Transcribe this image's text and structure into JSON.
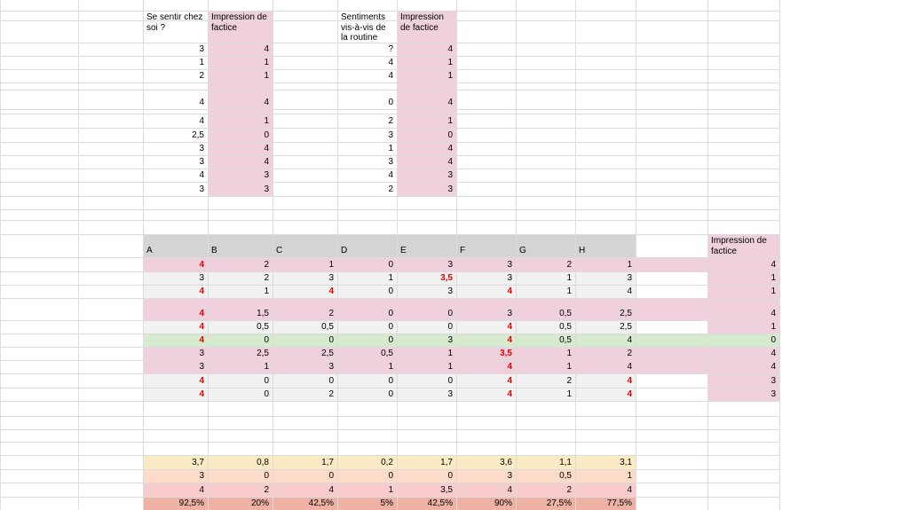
{
  "top_left": {
    "headers": [
      "Se sentir chez soi ?",
      "Impression de factice"
    ],
    "rows": [
      [
        "3",
        "4"
      ],
      [
        "1",
        "1"
      ],
      [
        "2",
        "1"
      ],
      [
        "4",
        "4"
      ],
      [
        "4",
        "1"
      ],
      [
        "2,5",
        "0"
      ],
      [
        "3",
        "4"
      ],
      [
        "3",
        "4"
      ],
      [
        "4",
        "3"
      ],
      [
        "3",
        "3"
      ]
    ]
  },
  "top_right": {
    "headers": [
      "Sentiments vis-à-vis de la routine",
      "Impression de factice"
    ],
    "rows": [
      [
        "?",
        "4"
      ],
      [
        "4",
        "1"
      ],
      [
        "4",
        "1"
      ],
      [
        "0",
        "4"
      ],
      [
        "2",
        "1"
      ],
      [
        "3",
        "0"
      ],
      [
        "1",
        "4"
      ],
      [
        "3",
        "4"
      ],
      [
        "4",
        "3"
      ],
      [
        "2",
        "3"
      ]
    ]
  },
  "main_table": {
    "columns": [
      "A",
      "B",
      "C",
      "D",
      "E",
      "F",
      "G",
      "H"
    ],
    "rows": [
      [
        "4",
        "2",
        "1",
        "0",
        "3",
        "3",
        "2",
        "1"
      ],
      [
        "3",
        "2",
        "3",
        "1",
        "3,5",
        "3",
        "1",
        "3"
      ],
      [
        "4",
        "1",
        "4",
        "0",
        "3",
        "4",
        "1",
        "4"
      ],
      [
        "4",
        "1,5",
        "2",
        "0",
        "0",
        "3",
        "0,5",
        "2,5"
      ],
      [
        "4",
        "0,5",
        "0,5",
        "0",
        "0",
        "4",
        "0,5",
        "2,5"
      ],
      [
        "4",
        "0",
        "0",
        "0",
        "3",
        "4",
        "0,5",
        "4"
      ],
      [
        "3",
        "2,5",
        "2,5",
        "0,5",
        "1",
        "3,5",
        "1",
        "2"
      ],
      [
        "3",
        "1",
        "3",
        "1",
        "1",
        "4",
        "1",
        "4"
      ],
      [
        "4",
        "0",
        "0",
        "0",
        "0",
        "4",
        "2",
        "4"
      ],
      [
        "4",
        "0",
        "2",
        "0",
        "3",
        "4",
        "1",
        "4"
      ]
    ],
    "emphasis": [
      [
        true,
        false,
        false,
        false,
        false,
        false,
        false,
        false
      ],
      [
        false,
        false,
        false,
        false,
        true,
        false,
        false,
        false
      ],
      [
        true,
        false,
        true,
        false,
        false,
        true,
        false,
        false
      ],
      [
        true,
        false,
        false,
        false,
        false,
        false,
        false,
        false
      ],
      [
        true,
        false,
        false,
        false,
        false,
        true,
        false,
        false
      ],
      [
        true,
        false,
        false,
        false,
        false,
        true,
        false,
        false
      ],
      [
        false,
        false,
        false,
        false,
        false,
        true,
        false,
        false
      ],
      [
        false,
        false,
        false,
        false,
        false,
        true,
        false,
        false
      ],
      [
        true,
        false,
        false,
        false,
        false,
        true,
        false,
        true
      ],
      [
        true,
        false,
        false,
        false,
        false,
        true,
        false,
        true
      ]
    ],
    "row_styles": [
      "pink",
      "lgray",
      "lgray",
      "pink",
      "lgray",
      "green",
      "pink",
      "pink",
      "lgray",
      "lgray"
    ]
  },
  "side_column": {
    "header": "Impression de factice",
    "values": [
      "4",
      "1",
      "1",
      "4",
      "1",
      "0",
      "4",
      "4",
      "3",
      "3"
    ]
  },
  "summary": {
    "rows": [
      [
        "3,7",
        "0,8",
        "1,7",
        "0,2",
        "1,7",
        "3,6",
        "1,1",
        "3,1"
      ],
      [
        "3",
        "0",
        "0",
        "0",
        "0",
        "3",
        "0,5",
        "1"
      ],
      [
        "4",
        "2",
        "4",
        "1",
        "3,5",
        "4",
        "2",
        "4"
      ],
      [
        "92,5%",
        "20%",
        "42,5%",
        "5%",
        "42,5%",
        "90%",
        "27,5%",
        "77,5%"
      ]
    ],
    "row_styles": [
      "yel",
      "org",
      "rose",
      "salm"
    ]
  },
  "colors": {
    "pink": "#efd0dc",
    "light_gray": "#f1f1f1",
    "green": "#d6ead0",
    "header_gray": "#d4d4d4",
    "yellow": "#fbebc4",
    "orange": "#fcdcc8",
    "rose": "#f8cccc",
    "salmon": "#eeb2a4",
    "emphasis_red": "#e00000",
    "grid": "#dcdcdc"
  }
}
